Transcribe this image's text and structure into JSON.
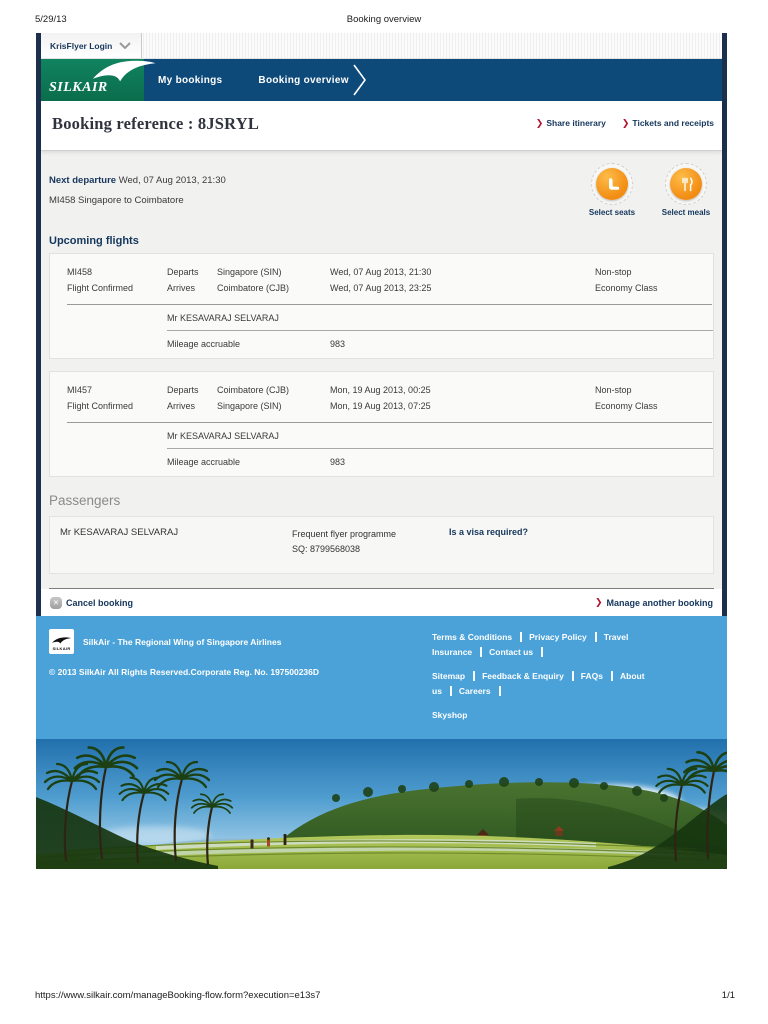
{
  "print_header": {
    "date": "5/29/13",
    "title": "Booking overview"
  },
  "print_footer": {
    "url": "https://www.silkair.com/manageBooking-flow.form?execution=e13s7",
    "page": "1/1"
  },
  "topbar": {
    "krisflyer_label": "KrisFlyer Login"
  },
  "brand": {
    "name": "SILKAIR",
    "footer_logo_text": "SILKAIR"
  },
  "nav": {
    "items": [
      {
        "label": "My bookings"
      },
      {
        "label": "Booking overview"
      }
    ]
  },
  "booking_header": {
    "title": "Booking reference : 8JSRYL",
    "links": [
      {
        "label": "Share itinerary"
      },
      {
        "label": "Tickets and receipts"
      }
    ]
  },
  "next_departure": {
    "label": "Next departure",
    "datetime": "Wed, 07 Aug 2013, 21:30",
    "flight": "MI458 Singapore to Coimbatore",
    "actions": [
      {
        "label": "Select seats"
      },
      {
        "label": "Select meals"
      }
    ]
  },
  "upcoming_flights": {
    "heading": "Upcoming flights",
    "flights": [
      {
        "number": "MI458",
        "status": "Flight Confirmed",
        "departs_label": "Departs",
        "arrives_label": "Arrives",
        "depart_city": "Singapore (SIN)",
        "arrive_city": "Coimbatore (CJB)",
        "depart_time": "Wed, 07 Aug 2013, 21:30",
        "arrive_time": "Wed, 07 Aug 2013, 23:25",
        "stops": "Non-stop",
        "cabin": "Economy Class",
        "passenger": "Mr KESAVARAJ SELVARAJ",
        "mileage_label": "Mileage accruable",
        "mileage": "983"
      },
      {
        "number": "MI457",
        "status": "Flight Confirmed",
        "departs_label": "Departs",
        "arrives_label": "Arrives",
        "depart_city": "Coimbatore (CJB)",
        "arrive_city": "Singapore (SIN)",
        "depart_time": "Mon, 19 Aug 2013, 00:25",
        "arrive_time": "Mon, 19 Aug 2013, 07:25",
        "stops": "Non-stop",
        "cabin": "Economy Class",
        "passenger": "Mr KESAVARAJ SELVARAJ",
        "mileage_label": "Mileage accruable",
        "mileage": "983"
      }
    ]
  },
  "passengers": {
    "heading": "Passengers",
    "rows": [
      {
        "name": "Mr KESAVARAJ SELVARAJ",
        "ff_label": "Frequent flyer programme",
        "ff_number": "SQ: 8799568038",
        "visa_link": "Is a visa required?"
      }
    ]
  },
  "actions": {
    "cancel": "Cancel booking",
    "manage": "Manage another booking"
  },
  "footer": {
    "tagline": "SilkAir - The Regional Wing of Singapore Airlines",
    "copyright": "© 2013 SilkAir All Rights Reserved.Corporate Reg. No. 197500236D",
    "links_row1": [
      "Terms & Conditions",
      "Privacy Policy",
      "Travel Insurance",
      "Contact us"
    ],
    "links_row2": [
      "Sitemap",
      "Feedback & Enquiry",
      "FAQs",
      "About us",
      "Careers"
    ],
    "links_row3": [
      "Skyshop"
    ]
  },
  "colors": {
    "nav_navy": "#0d4979",
    "frame_navy": "#1c2f4d",
    "brand_green": "#0d7a56",
    "footer_blue": "#4aa2d8",
    "accent_orange": "#f28c12",
    "accent_red": "#b5112f"
  }
}
